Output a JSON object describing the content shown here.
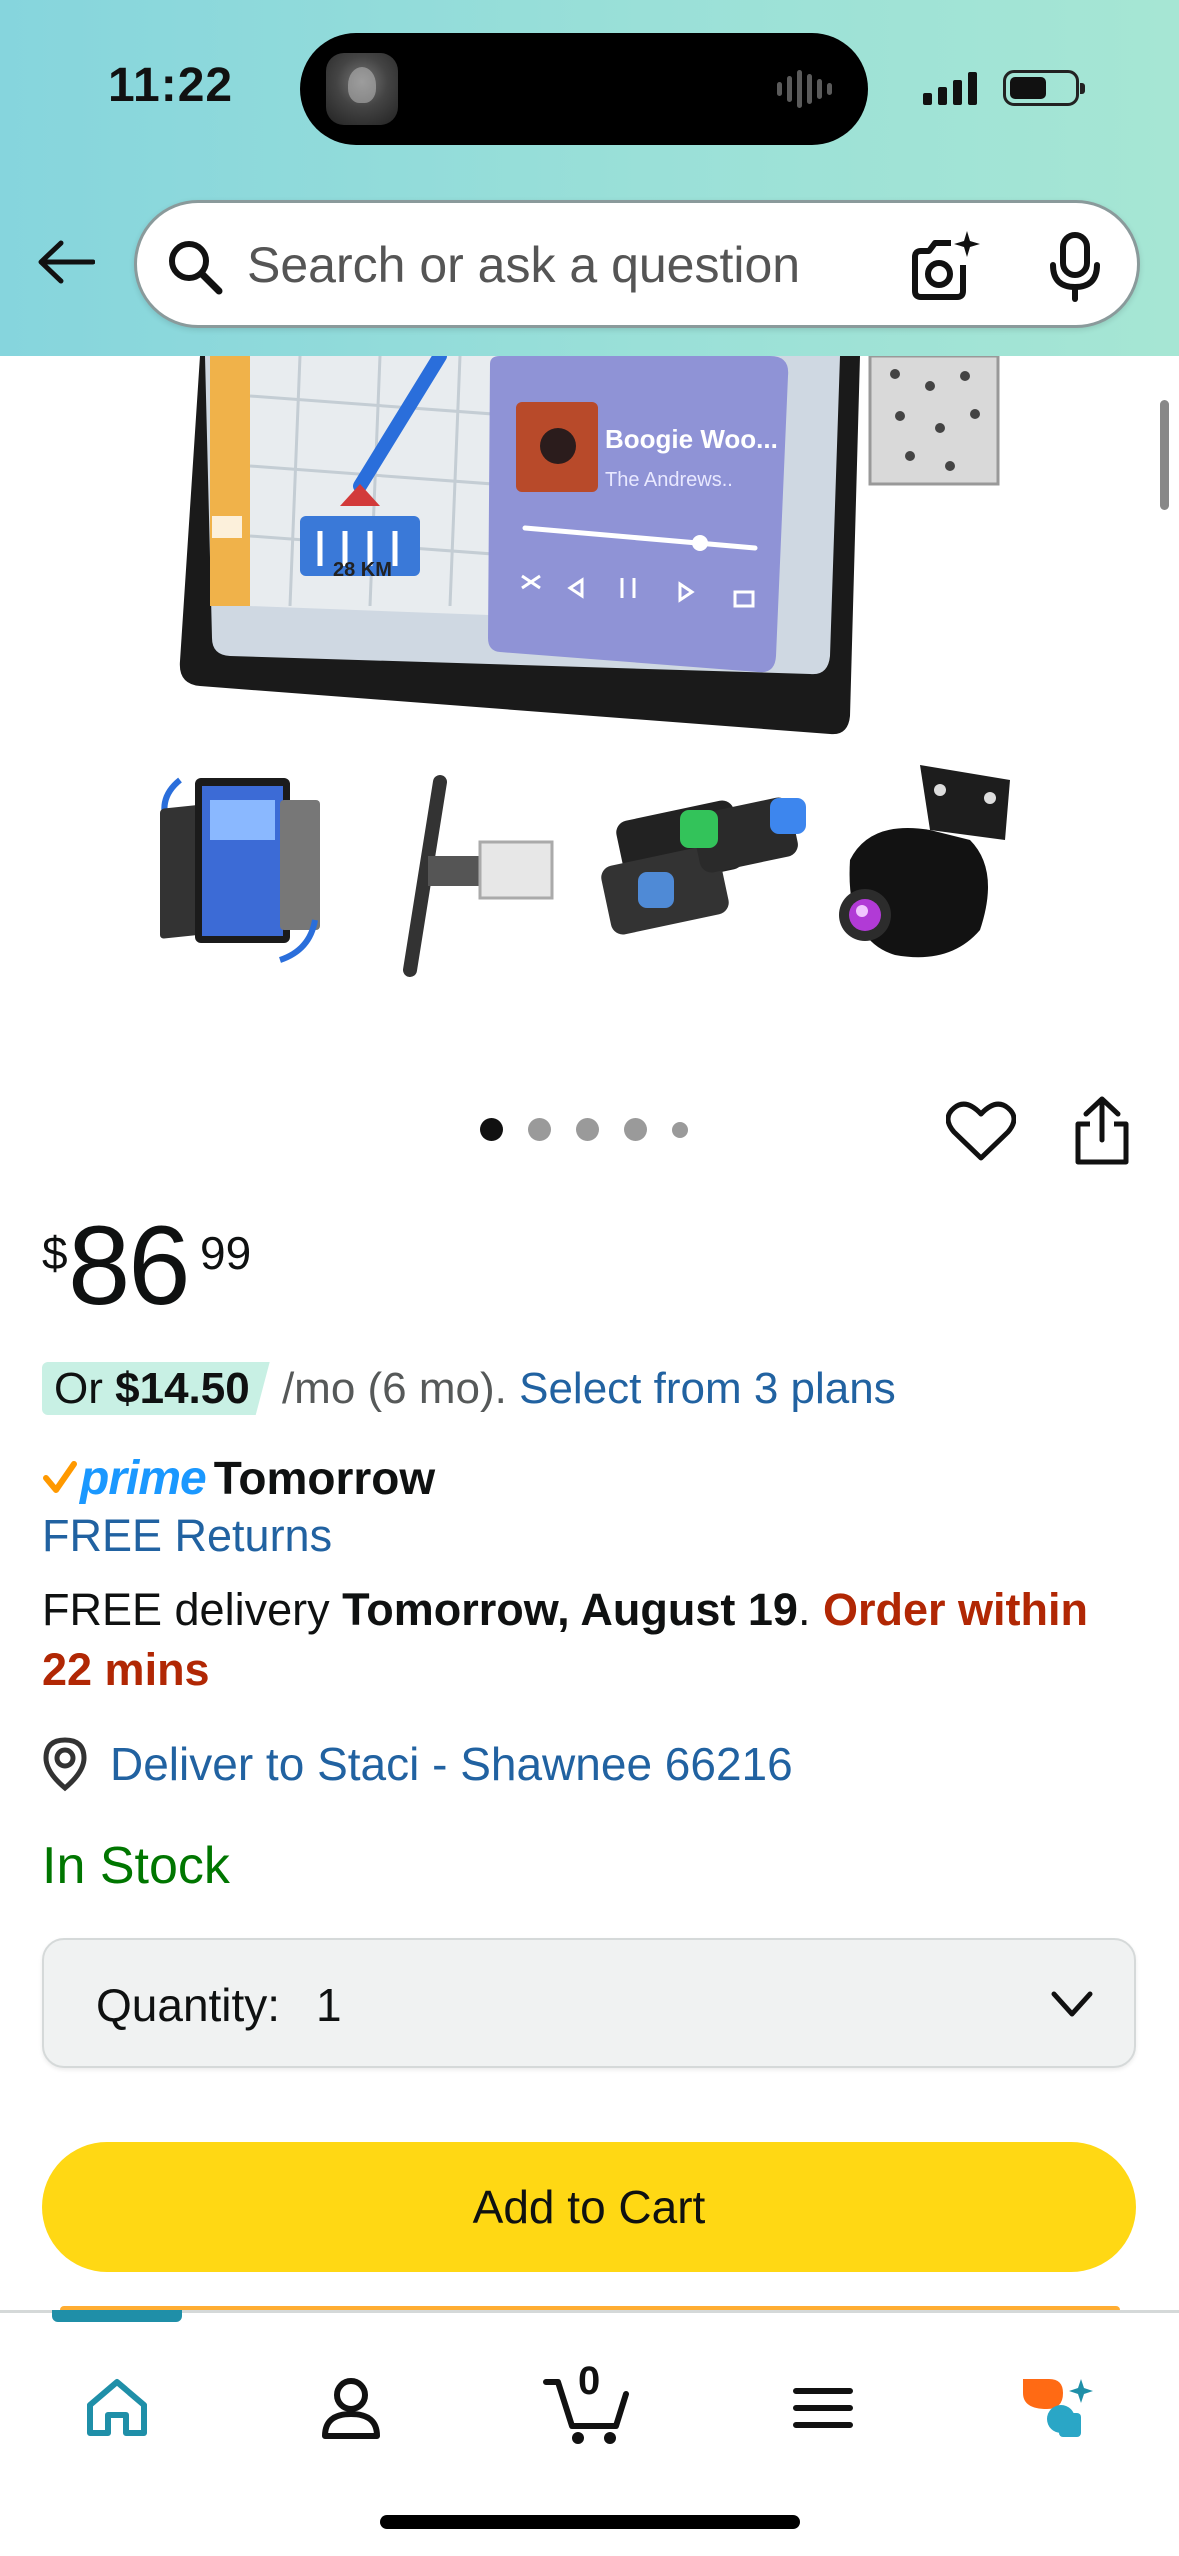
{
  "status_bar": {
    "time": "11:22"
  },
  "search": {
    "placeholder": "Search or ask a question"
  },
  "product_screen": {
    "song_title": "Boogie Woo...",
    "song_artist": "The Andrews..",
    "map_distance": "28 KM"
  },
  "image_pager": {
    "total": 5,
    "active_index": 0
  },
  "price": {
    "symbol": "$",
    "whole": "86",
    "fraction": "99"
  },
  "installment": {
    "prefix": "Or",
    "amount": "$14.50",
    "term": "/mo (6 mo).",
    "link": "Select from 3 plans"
  },
  "prime": {
    "logo": "prime",
    "day": "Tomorrow"
  },
  "returns": "FREE Returns",
  "delivery": {
    "prefix": "FREE delivery",
    "date": "Tomorrow, August 19",
    "separator": ".",
    "cutoff": "Order within 22 mins"
  },
  "location": "Deliver to Staci - Shawnee 66216",
  "stock": "In Stock",
  "quantity": {
    "label": "Quantity:",
    "value": "1"
  },
  "add_to_cart": "Add to Cart",
  "bottom_nav": {
    "cart_count": "0",
    "active": "home"
  },
  "colors": {
    "header_gradient": "#9ae0d8",
    "link": "#2162a1",
    "in_stock": "#007600",
    "urgent": "#b12704",
    "add_to_cart": "#ffd814",
    "prime_blue": "#1a98ff",
    "nav_active": "#1f8fa8"
  },
  "icons": [
    "back-arrow-icon",
    "search-icon",
    "camera-lens-icon",
    "microphone-icon",
    "heart-icon",
    "share-icon",
    "location-pin-icon",
    "chevron-down-icon",
    "home-icon",
    "account-icon",
    "cart-icon",
    "menu-icon",
    "rufus-ai-icon"
  ]
}
